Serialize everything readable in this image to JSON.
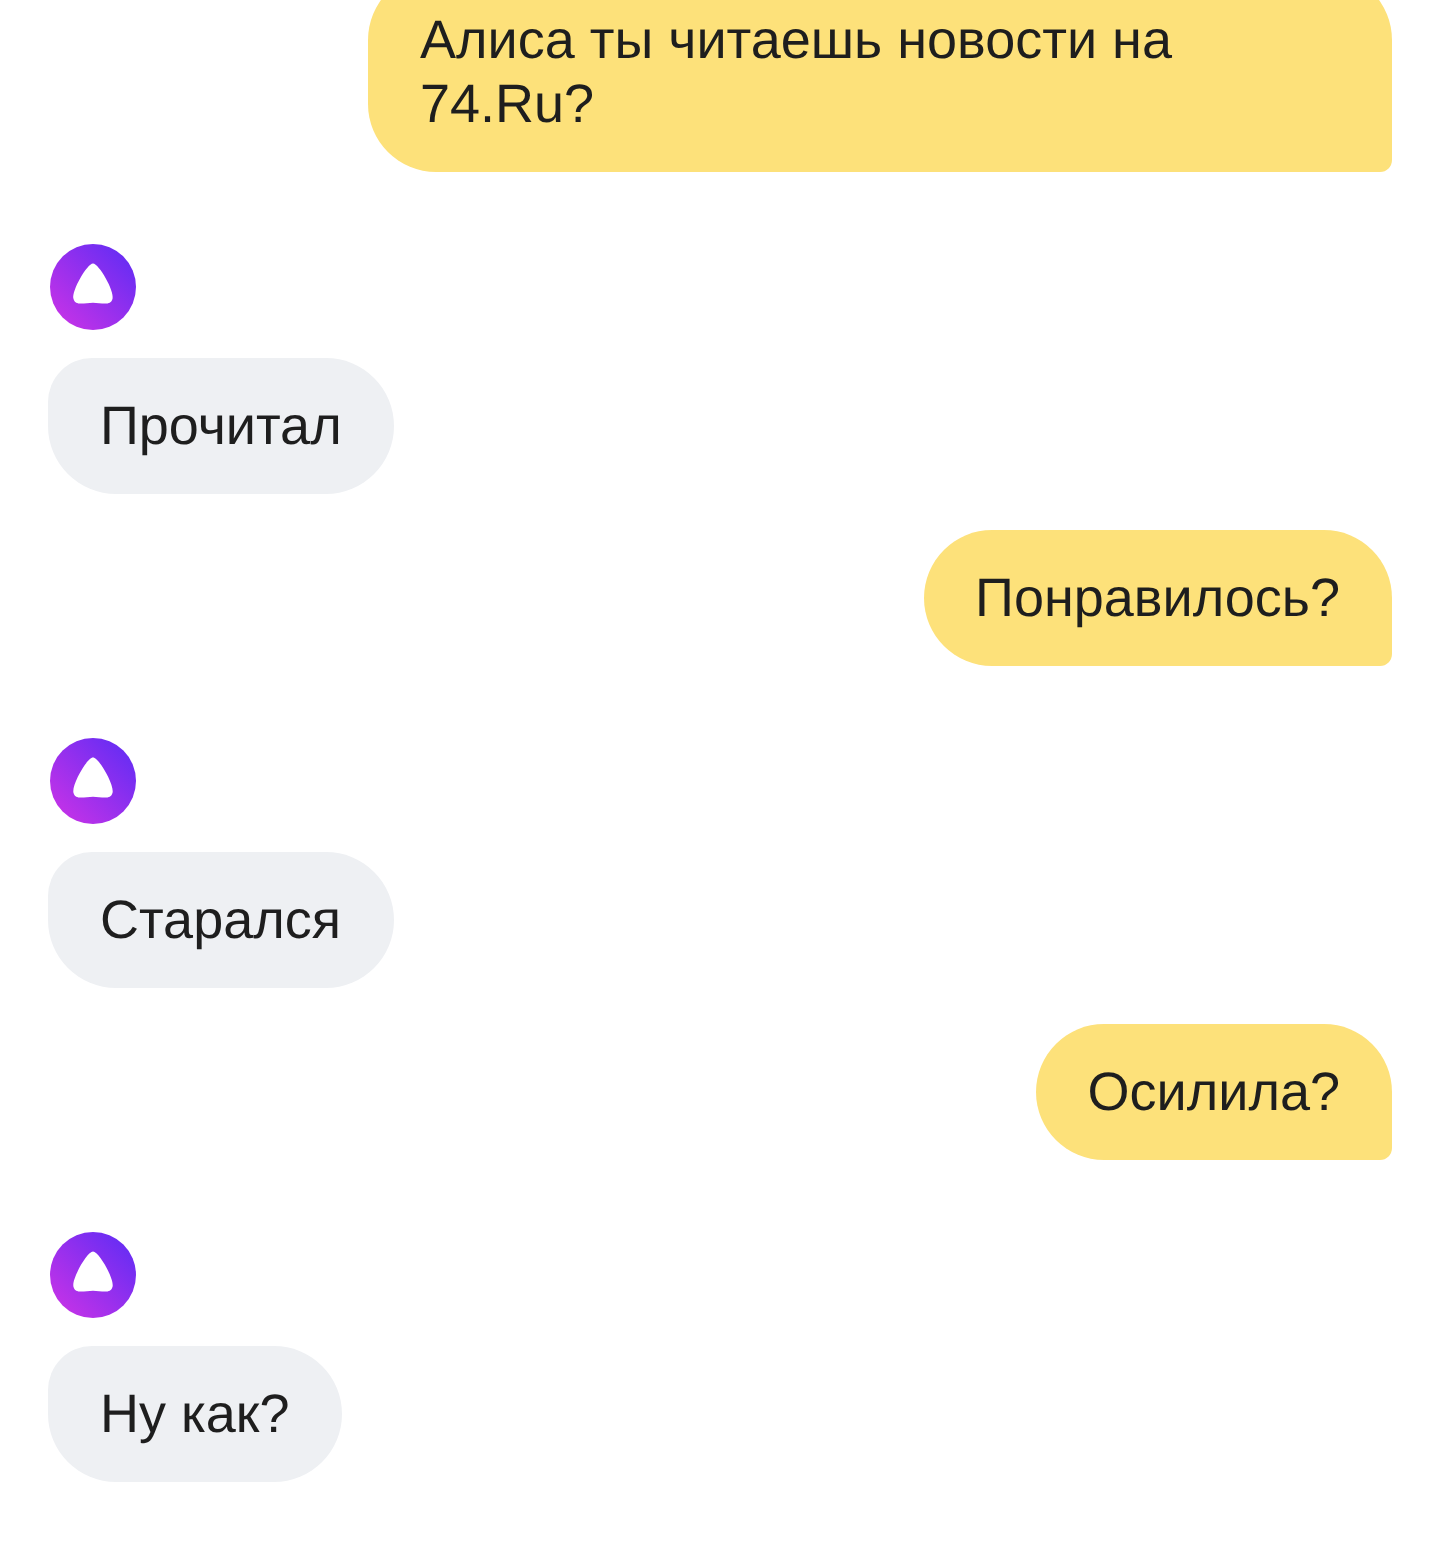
{
  "messages": [
    {
      "kind": "user",
      "text": "Алиса ты читаешь новости на 74.Ru?"
    },
    {
      "kind": "assistant",
      "text": "Прочитал"
    },
    {
      "kind": "user",
      "text": "Понравилось?"
    },
    {
      "kind": "assistant",
      "text": "Старался"
    },
    {
      "kind": "user",
      "text": "Осилила?"
    },
    {
      "kind": "assistant",
      "text": "Ну как?"
    }
  ]
}
